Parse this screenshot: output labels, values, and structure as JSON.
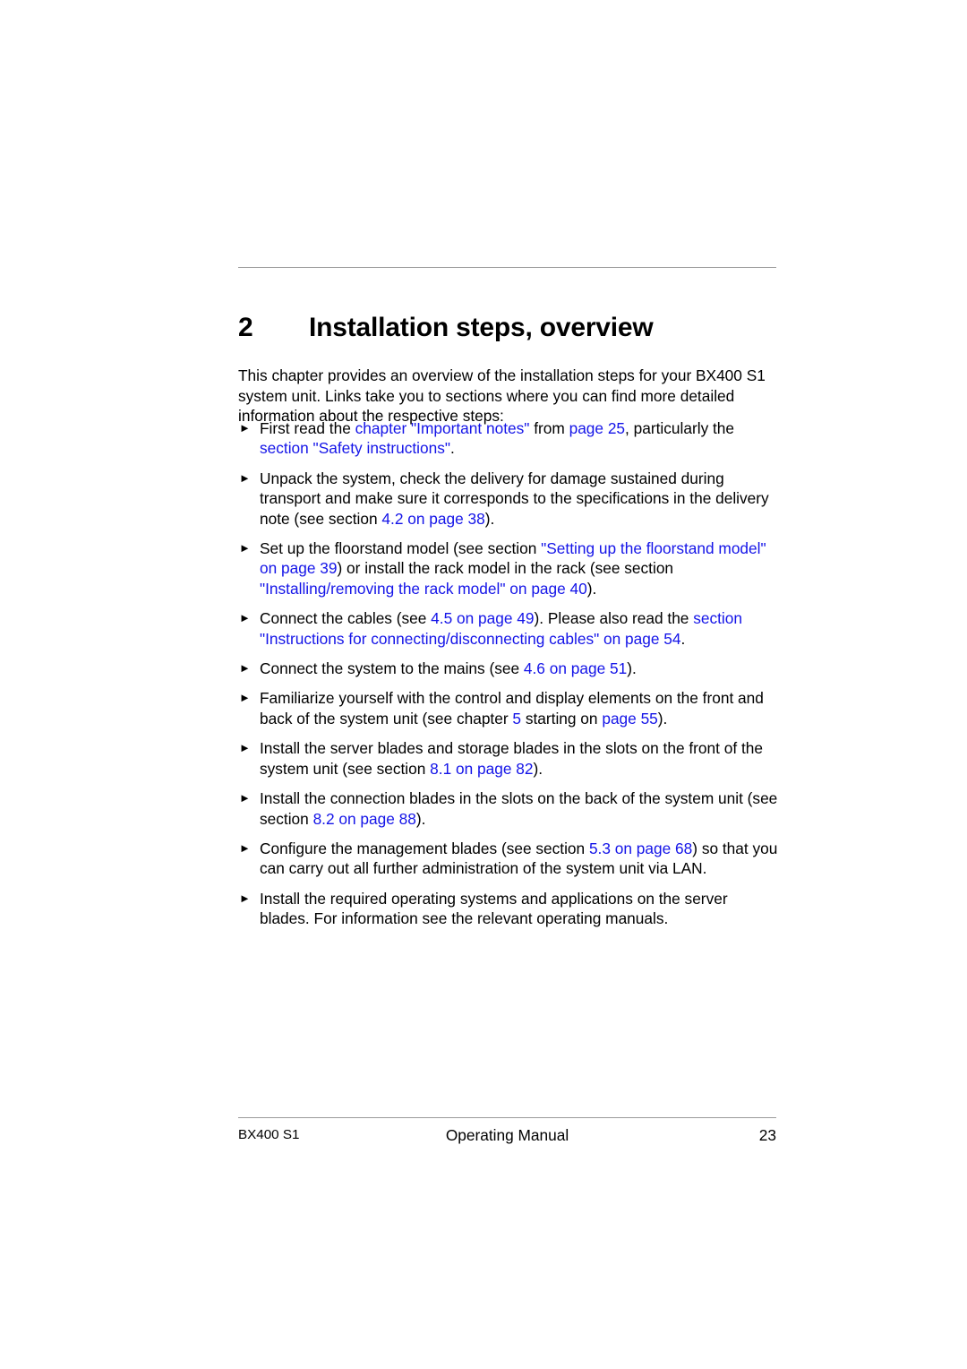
{
  "document": {
    "chapter_number": "2",
    "chapter_title": "Installation steps, overview",
    "link_color": "#1414e8",
    "rule_color": "#9a9a9a"
  },
  "intro": {
    "text": "This chapter provides an overview of the installation steps for your BX400 S1 system unit. Links take you to sections where you can find more detailed information about the respective steps:"
  },
  "bullet_glyph": "►",
  "steps": [
    {
      "id": "step-important-notes",
      "parts": [
        {
          "t": "First read the ",
          "link": false
        },
        {
          "t": "chapter \"Important notes\"",
          "link": true
        },
        {
          "t": " from ",
          "link": false
        },
        {
          "t": "page 25",
          "link": true
        },
        {
          "t": ", particularly the ",
          "link": false
        },
        {
          "t": "section \"Safety instructions\"",
          "link": true
        },
        {
          "t": ".",
          "link": false
        }
      ]
    },
    {
      "id": "step-unpack-system",
      "parts": [
        {
          "t": "Unpack the system, check the delivery for damage sustained during transport and make sure it corresponds to the specifications in the delivery note (see section ",
          "link": false
        },
        {
          "t": "4.2 on page 38",
          "link": true
        },
        {
          "t": ").",
          "link": false
        }
      ]
    },
    {
      "id": "step-setup-floorstand-or-rack",
      "parts": [
        {
          "t": "Set up the floorstand model (see section ",
          "link": false
        },
        {
          "t": "\"Setting up the floorstand model\" on page 39",
          "link": true
        },
        {
          "t": ") or install the rack model in the rack (see section ",
          "link": false
        },
        {
          "t": "\"Installing/removing the rack model\" on page 40",
          "link": true
        },
        {
          "t": ").",
          "link": false
        }
      ]
    },
    {
      "id": "step-connect-cables",
      "parts": [
        {
          "t": "Connect the cables (see ",
          "link": false
        },
        {
          "t": "4.5 on page 49",
          "link": true
        },
        {
          "t": "). Please also read the ",
          "link": false
        },
        {
          "t": "section \"Instructions for connecting/disconnecting cables\" on page 54",
          "link": true
        },
        {
          "t": ".",
          "link": false
        }
      ]
    },
    {
      "id": "step-connect-mains",
      "parts": [
        {
          "t": "Connect the system to the mains (see ",
          "link": false
        },
        {
          "t": "4.6 on page 51",
          "link": true
        },
        {
          "t": ").",
          "link": false
        }
      ]
    },
    {
      "id": "step-familiarize-controls",
      "parts": [
        {
          "t": "Familiarize yourself with the control and display elements on the front and back of the system unit (see chapter ",
          "link": false
        },
        {
          "t": "5",
          "link": true
        },
        {
          "t": " starting on ",
          "link": false
        },
        {
          "t": "page 55",
          "link": true
        },
        {
          "t": ").",
          "link": false
        }
      ]
    },
    {
      "id": "step-install-server-storage-blades",
      "parts": [
        {
          "t": "Install the server blades and storage blades in the slots on the front of the system unit (see section ",
          "link": false
        },
        {
          "t": "8.1 on page 82",
          "link": true
        },
        {
          "t": ").",
          "link": false
        }
      ]
    },
    {
      "id": "step-install-connection-blades",
      "parts": [
        {
          "t": "Install the connection blades in the slots on the back of the system unit (see section ",
          "link": false
        },
        {
          "t": "8.2 on page 88",
          "link": true
        },
        {
          "t": ").",
          "link": false
        }
      ]
    },
    {
      "id": "step-configure-management-blades",
      "parts": [
        {
          "t": "Configure the management blades (see section ",
          "link": false
        },
        {
          "t": "5.3 on page 68",
          "link": true
        },
        {
          "t": ") so that you can carry out all further administration of the system unit via LAN.",
          "link": false
        }
      ]
    },
    {
      "id": "step-install-operating-systems",
      "parts": [
        {
          "t": "Install the required operating systems and applications on the server blades. For information see the relevant operating manuals.",
          "link": false
        }
      ]
    }
  ],
  "footer": {
    "left": "BX400 S1",
    "center": "Operating Manual",
    "right": "23"
  }
}
